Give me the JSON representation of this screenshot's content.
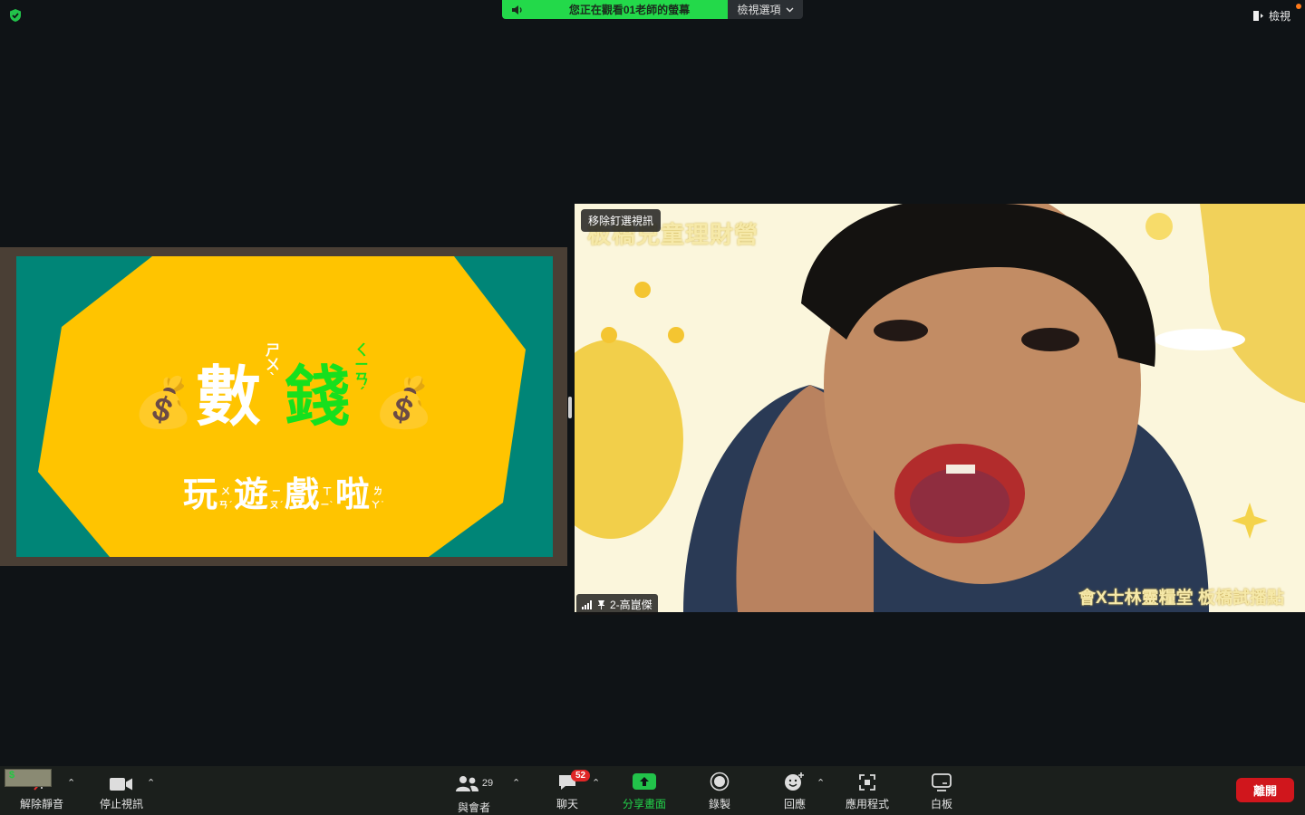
{
  "banner": {
    "status_text": "您正在觀看01老師的螢幕",
    "options_label": "檢視選項"
  },
  "top_right": {
    "view_label": "檢視"
  },
  "slide": {
    "title_part1": "數",
    "title_bopomofo1": "ㄕㄨˋ",
    "title_part2": "錢",
    "title_bopomofo2": "ㄑㄧㄢˊ",
    "subtitle_chars": [
      "玩",
      "遊",
      "戲",
      "啦"
    ],
    "subtitle_bopomofo": [
      "ㄨㄢˊ",
      "ㄧㄡˊ",
      "ㄒㄧˋ",
      "ㄌㄚ˙"
    ],
    "colors": {
      "background": "#008577",
      "panel": "#ffc400",
      "accent_green": "#16e01d"
    }
  },
  "video": {
    "unpin_label": "移除釘選視訊",
    "participant_name": "2-高崑傑",
    "background_title": "板橋兒童理財營",
    "background_footer": "會X士林靈糧堂 板橋試播點"
  },
  "toolbar": {
    "unmute_label": "解除靜音",
    "stop_video_label": "停止視訊",
    "participants_label": "與會者",
    "participants_count": "29",
    "chat_label": "聊天",
    "chat_badge": "52",
    "share_label": "分享畫面",
    "record_label": "錄製",
    "reactions_label": "回應",
    "apps_label": "應用程式",
    "whiteboard_label": "白板",
    "leave_label": "離開",
    "thumb_sign": "$"
  }
}
